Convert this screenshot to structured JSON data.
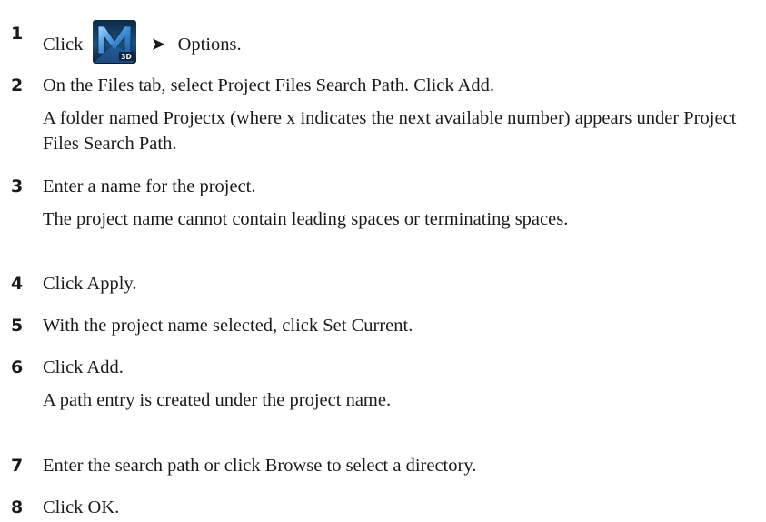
{
  "steps": [
    {
      "number": "1",
      "before_icon": "Click",
      "icon": "application-menu-3d-icon",
      "icon_badge": "3D",
      "arrow": "➤",
      "after_icon": "Options."
    },
    {
      "number": "2",
      "text": "On the Files tab, select Project Files Search Path. Click Add.",
      "note": "A folder named Projectx (where x indicates the next available number) appears under Project Files Search Path."
    },
    {
      "number": "3",
      "text": "Enter a name for the project.",
      "note": "The project name cannot contain leading spaces or terminating spaces."
    },
    {
      "number": "4",
      "text": "Click Apply."
    },
    {
      "number": "5",
      "text": "With the project name selected, click Set Current."
    },
    {
      "number": "6",
      "text": "Click Add.",
      "note": "A path entry is created under the project name."
    },
    {
      "number": "7",
      "text": "Enter the search path or click Browse to select a directory."
    },
    {
      "number": "8",
      "text": "Click OK."
    }
  ]
}
